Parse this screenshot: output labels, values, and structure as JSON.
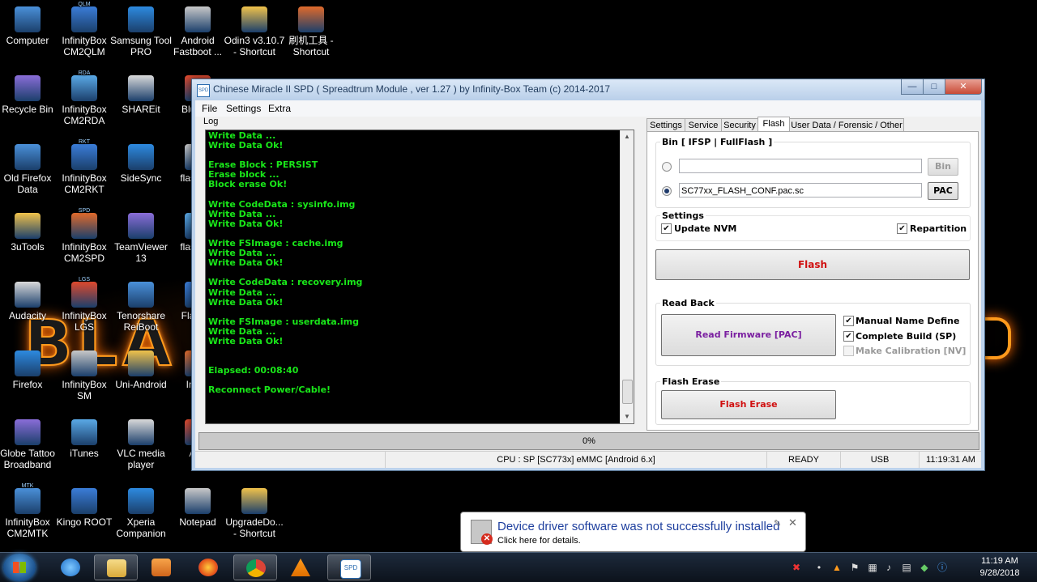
{
  "desktop": {
    "icons": [
      {
        "label": "Computer",
        "tag": ""
      },
      {
        "label": "InfinityBox CM2QLM",
        "tag": "QLM"
      },
      {
        "label": "Samsung Tool PRO",
        "tag": ""
      },
      {
        "label": "Android Fastboot ...",
        "tag": ""
      },
      {
        "label": "Odin3 v3.10.7 - Shortcut",
        "tag": ""
      },
      {
        "label": "刷机工具 - Shortcut",
        "tag": ""
      },
      {
        "label": "Recycle Bin",
        "tag": ""
      },
      {
        "label": "InfinityBox CM2RDA",
        "tag": "RDA"
      },
      {
        "label": "SHAREit",
        "tag": ""
      },
      {
        "label": "Blu File",
        "tag": ""
      },
      {
        "label": "Old Firefox Data",
        "tag": ""
      },
      {
        "label": "InfinityBox CM2RKT",
        "tag": "RKT"
      },
      {
        "label": "SideSync",
        "tag": ""
      },
      {
        "label": "flas Sho",
        "tag": ""
      },
      {
        "label": "3uTools",
        "tag": ""
      },
      {
        "label": "InfinityBox CM2SPD",
        "tag": "SPD"
      },
      {
        "label": "TeamViewer 13",
        "tag": ""
      },
      {
        "label": "flas Sho",
        "tag": ""
      },
      {
        "label": "Audacity",
        "tag": ""
      },
      {
        "label": "InfinityBox LGS",
        "tag": "LGS"
      },
      {
        "label": "Tenorshare ReiBoot",
        "tag": ""
      },
      {
        "label": "Flas Sh",
        "tag": ""
      },
      {
        "label": "Firefox",
        "tag": ""
      },
      {
        "label": "InfinityBox SM",
        "tag": ""
      },
      {
        "label": "Uni-Android",
        "tag": ""
      },
      {
        "label": "In Do",
        "tag": ""
      },
      {
        "label": "Globe Tattoo Broadband",
        "tag": ""
      },
      {
        "label": "iTunes",
        "tag": ""
      },
      {
        "label": "VLC media player",
        "tag": ""
      },
      {
        "label": "And",
        "tag": ""
      },
      {
        "label": "InfinityBox CM2MTK",
        "tag": "MTK"
      },
      {
        "label": "Kingo ROOT",
        "tag": ""
      },
      {
        "label": "Xperia Companion",
        "tag": ""
      },
      {
        "label": "Notepad",
        "tag": ""
      },
      {
        "label": "UpgradeDo... - Shortcut",
        "tag": ""
      }
    ]
  },
  "window": {
    "title": "Chinese Miracle II SPD ( Spreadtrum Module , ver 1.27 ) by Infinity-Box Team (c) 2014-2017",
    "menu": [
      "File",
      "Settings",
      "Extra"
    ],
    "log_label": "Log",
    "log_lines": [
      "Write Data ...",
      "Write Data Ok!",
      "",
      "Erase Block : PERSIST",
      "Erase block ...",
      "Block erase Ok!",
      "",
      "Write CodeData : sysinfo.img",
      "Write Data ...",
      "Write Data Ok!",
      "",
      "Write FSImage : cache.img",
      "Write Data ...",
      "Write Data Ok!",
      "",
      "Write CodeData : recovery.img",
      "Write Data ...",
      "Write Data Ok!",
      "",
      "Write FSImage : userdata.img",
      "Write Data ...",
      "Write Data Ok!",
      "",
      "",
      "Elapsed: 00:08:40",
      "",
      "Reconnect Power/Cable!"
    ],
    "tabs": [
      "Settings",
      "Service",
      "Security",
      "Flash",
      "User Data / Forensic / Other"
    ],
    "active_tab": "Flash",
    "flash": {
      "bin_group": "Bin  [ IFSP | FullFlash ]",
      "bin_path": "",
      "bin_button": "Bin",
      "pac_path": "SC77xx_FLASH_CONF.pac.sc",
      "pac_button": "PAC",
      "settings_group": "Settings",
      "update_nvm": "Update NVM",
      "repartition": "Repartition",
      "flash_button": "Flash",
      "readback_group": "Read Back",
      "read_firmware_button": "Read Firmware [PAC]",
      "manual_name": "Manual Name Define",
      "complete_build": "Complete Build (SP)",
      "make_calibration": "Make Calibration [NV]",
      "flash_erase_group": "Flash Erase",
      "flash_erase_button": "Flash Erase"
    },
    "progress_text": "0%",
    "status": {
      "cpu": "CPU : SP [SC773x] eMMC [Android 6.x]",
      "state": "READY",
      "port": "USB",
      "time": "11:19:31 AM"
    }
  },
  "notification": {
    "title": "Device driver software was not successfully installed",
    "subtitle": "Click here for details."
  },
  "taskbar": {
    "clock_time": "11:19 AM",
    "clock_date": "9/28/2018",
    "spd_label": "SPD"
  },
  "colors": {
    "log_text": "#19e619",
    "flash_label": "#d01010",
    "read_firmware_label": "#7a1fa0",
    "notification_title": "#1e3f9e"
  }
}
